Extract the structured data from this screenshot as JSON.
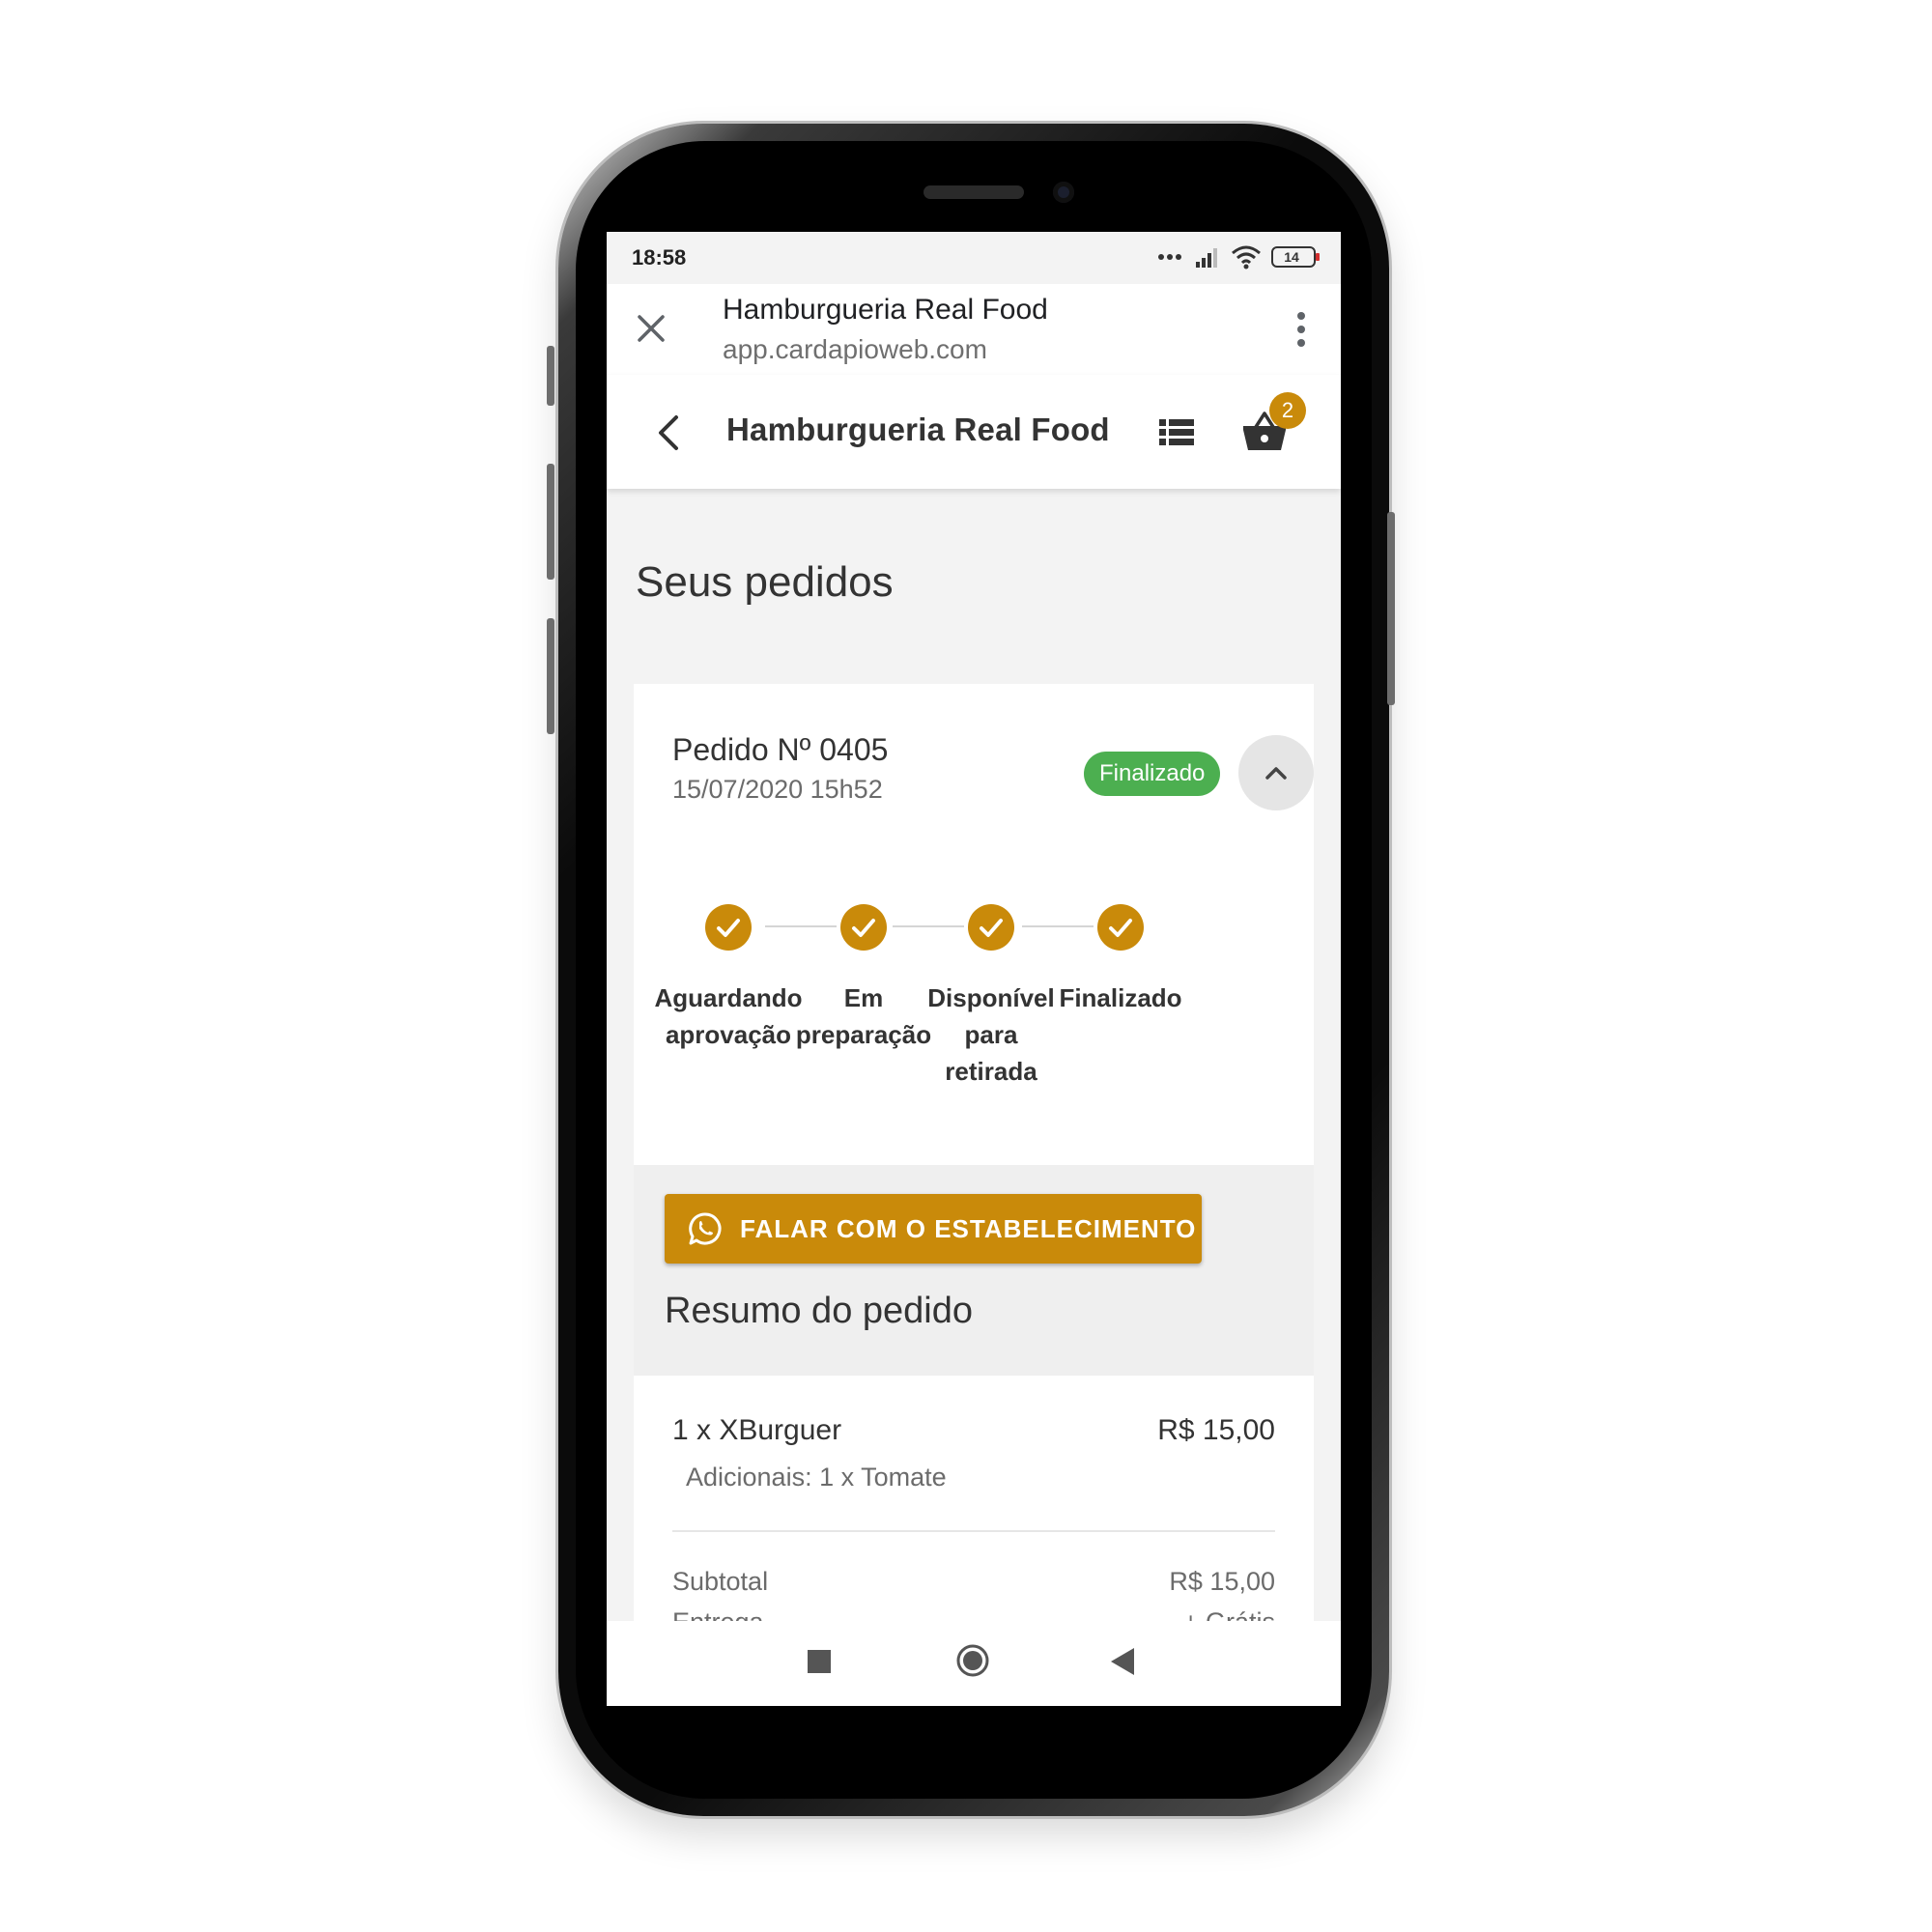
{
  "status_bar": {
    "time": "18:58",
    "battery": "14"
  },
  "browser_bar": {
    "title": "Hamburgueria Real Food",
    "url": "app.cardapioweb.com"
  },
  "app_bar": {
    "title": "Hamburgueria Real Food",
    "cart_count": "2",
    "icons": [
      "back-arrow-icon",
      "list-icon",
      "basket-icon"
    ]
  },
  "page": {
    "heading": "Seus pedidos"
  },
  "order": {
    "number": "Pedido Nº 0405",
    "datetime": "15/07/2020 15h52",
    "status": "Finalizado",
    "steps": [
      {
        "line1": "Aguardando",
        "line2": "aprovação",
        "line3": ""
      },
      {
        "line1": "Em",
        "line2": "preparação",
        "line3": ""
      },
      {
        "line1": "Disponível",
        "line2": "para",
        "line3": "retirada"
      },
      {
        "line1": "Finalizado",
        "line2": "",
        "line3": ""
      }
    ],
    "contact_button": "FALAR COM O ESTABELECIMENTO",
    "summary_title": "Resumo do pedido",
    "item": {
      "name": "1 x XBurguer",
      "price": "R$ 15,00",
      "extras": "Adicionais: 1 x Tomate"
    },
    "subtotal_label": "Subtotal",
    "subtotal_value": "R$ 15,00",
    "delivery_label": "Entrega",
    "delivery_value": "+ Grátis"
  },
  "colors": {
    "accent": "#c98a0a",
    "status_green": "#4caf50",
    "background": "#f3f3f3"
  }
}
